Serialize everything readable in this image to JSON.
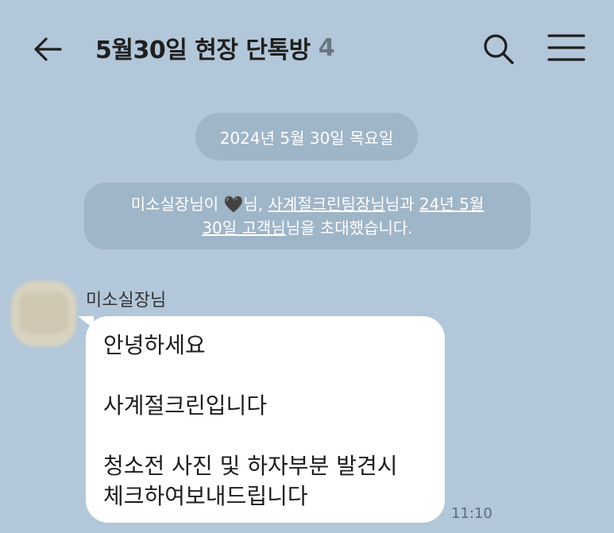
{
  "header": {
    "title": "5월30일 현장 단톡방",
    "member_count": "4",
    "back_icon": "arrow-left-icon",
    "search_icon": "search-icon",
    "menu_icon": "hamburger-menu-icon"
  },
  "chat": {
    "date_divider": "2024년 5월 30일 목요일",
    "system_notice": {
      "inviter": "미소실장님",
      "text_1": "이 ",
      "heart_emoji": "🖤",
      "text_2": "님, ",
      "invitee_1": "사계절크린팀장님",
      "text_3": "님과 ",
      "invitee_2_part1": "24년 5월",
      "invitee_2_part2": "30일 고객님",
      "text_4": "님을 초대했습니다."
    },
    "messages": [
      {
        "sender": "미소실장님",
        "lines": [
          "안녕하세요",
          "",
          "사계절크린입니다",
          "",
          "청소전 사진 및 하자부분 발견시",
          "체크하여보내드립니다"
        ],
        "time": "11:10"
      }
    ]
  },
  "colors": {
    "background": "#b2c7d9",
    "bubble": "#ffffff",
    "system_pill": "rgba(110,135,158,0.28)",
    "title_text": "#1f1f1f"
  }
}
